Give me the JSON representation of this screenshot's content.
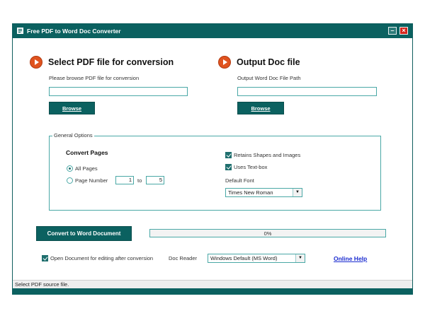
{
  "window": {
    "title": "Free PDF to Word Doc Converter",
    "minimize_glyph": "–",
    "close_glyph": "×"
  },
  "input_section": {
    "title": "Select PDF file for conversion",
    "hint": "Please browse PDF file for conversion",
    "path_value": "",
    "browse_label": "Browse"
  },
  "output_section": {
    "title": "Output Doc file",
    "hint": "Output Word Doc File Path",
    "path_value": "",
    "browse_label": "Browse"
  },
  "general_options": {
    "legend": "General Options",
    "convert_pages_label": "Convert Pages",
    "all_pages_label": "All Pages",
    "all_pages_selected": true,
    "page_number_label": "Page Number",
    "page_from": "1",
    "to_label": "to",
    "page_to": "5",
    "retain_shapes_label": "Retains Shapes and Images",
    "retain_shapes_checked": true,
    "uses_textbox_label": "Uses Text-box",
    "uses_textbox_checked": true,
    "default_font_label": "Default Font",
    "default_font_value": "Times New Roman"
  },
  "actions": {
    "convert_label": "Convert to Word Document",
    "progress_percent": 0,
    "progress_text": "0%"
  },
  "footer_options": {
    "open_doc_label": "Open Document for editing after conversion",
    "open_doc_checked": true,
    "doc_reader_label": "Doc Reader",
    "doc_reader_value": "Windows Default (MS Word)",
    "online_help_label": "Online Help"
  },
  "status": {
    "text": "Select PDF source file."
  },
  "colors": {
    "accent": "#0b6160",
    "arrow_icon": "#e0531f",
    "link": "#1a2bd0",
    "close": "#d4261c"
  },
  "icons": [
    "app-icon",
    "minimize-icon",
    "close-icon",
    "arrow-circle-icon",
    "dropdown-arrow-icon",
    "checkbox-icon",
    "radio-icon"
  ]
}
